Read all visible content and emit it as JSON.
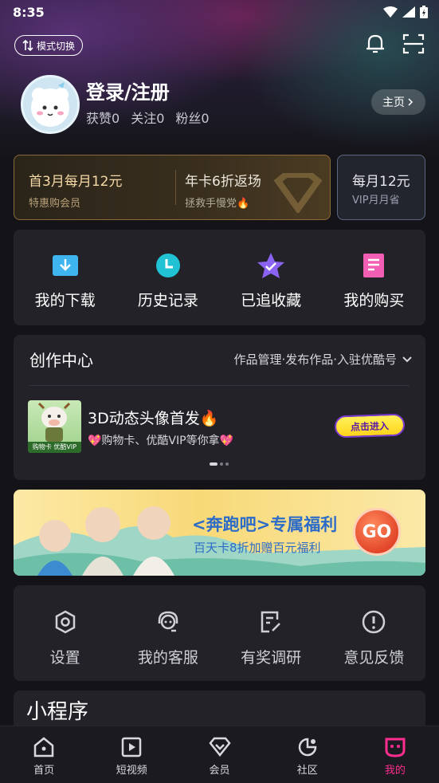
{
  "status_bar": {
    "time": "8:35"
  },
  "header": {
    "mode_switch_label": "模式切换"
  },
  "profile": {
    "name": "登录/注册",
    "stats": [
      "获赞0",
      "关注0",
      "粉丝0"
    ],
    "home_button": "主页"
  },
  "vip": {
    "offer1_title": "首3月每月12元",
    "offer1_sub": "特惠购会员",
    "offer2_title": "年卡6折返场",
    "offer2_sub": "拯救手慢党🔥",
    "offer3_title": "每月12元",
    "offer3_sub": "VIP月月省"
  },
  "quick_actions": [
    {
      "label": "我的下载",
      "icon": "download-icon",
      "color": "#3fb5f0"
    },
    {
      "label": "历史记录",
      "icon": "clock-icon",
      "color": "#20c2d4"
    },
    {
      "label": "已追收藏",
      "icon": "star-icon",
      "color": "#8a63f2"
    },
    {
      "label": "我的购买",
      "icon": "receipt-icon",
      "color": "#f25eb3"
    }
  ],
  "creation": {
    "title": "创作中心",
    "links": "作品管理·发布作品·入驻优酷号",
    "promo_title": "3D动态头像首发🔥",
    "promo_sub": "💖购物卡、优酷VIP等你拿💖",
    "promo_thumb_text": "购物卡 优酷VIP",
    "enter_button": "点击进入"
  },
  "banner": {
    "title": "<奔跑吧>专属福利",
    "subtitle": "百天卡8折加赠百元福利",
    "go_label": "GO"
  },
  "services": [
    {
      "label": "设置",
      "icon": "settings-icon"
    },
    {
      "label": "我的客服",
      "icon": "customer-service-icon"
    },
    {
      "label": "有奖调研",
      "icon": "survey-icon"
    },
    {
      "label": "意见反馈",
      "icon": "feedback-icon"
    }
  ],
  "mini_programs": {
    "title": "小程序"
  },
  "tabs": [
    {
      "label": "首页",
      "icon": "home-icon",
      "active": false
    },
    {
      "label": "短视频",
      "icon": "video-icon",
      "active": false
    },
    {
      "label": "会员",
      "icon": "vip-diamond-icon",
      "active": false
    },
    {
      "label": "社区",
      "icon": "community-icon",
      "active": false
    },
    {
      "label": "我的",
      "icon": "profile-icon",
      "active": true
    }
  ],
  "colors": {
    "accent": "#ff2d8e",
    "gold": "#f5d9a6",
    "background": "#141418",
    "panel": "#222228"
  }
}
